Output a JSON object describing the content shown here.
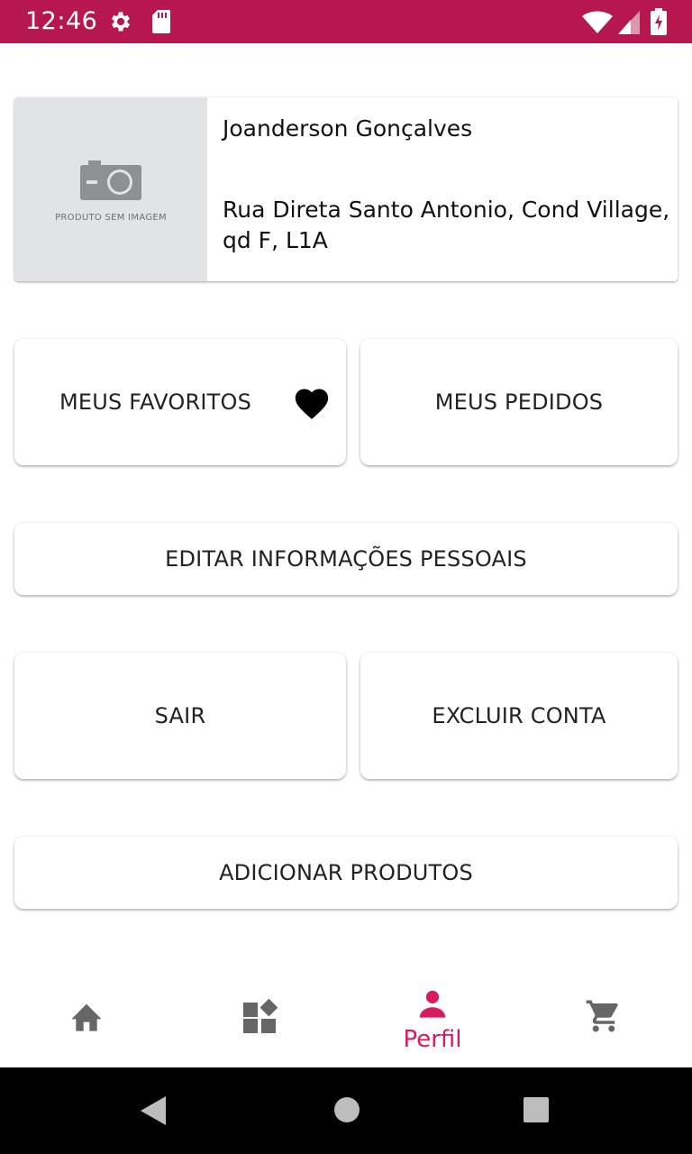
{
  "status_bar": {
    "time": "12:46",
    "icons": [
      "settings-icon",
      "sd-card-icon",
      "wifi-icon",
      "signal-icon",
      "battery-charging-icon"
    ],
    "background_color": "#b5174e"
  },
  "profile": {
    "name": "Joanderson Gonçalves",
    "address": "Rua Direta Santo Antonio, Cond Village, qd F, L1A",
    "no_image_text": "PRODUTO SEM IMAGEM",
    "placeholder_icon": "camera-icon"
  },
  "actions": {
    "favorites": {
      "label": "MEUS FAVORITOS",
      "icon": "heart-icon"
    },
    "orders": {
      "label": "MEUS PEDIDOS"
    },
    "edit_info": {
      "label": "EDITAR INFORMAÇÕES PESSOAIS"
    },
    "logout": {
      "label": "SAIR"
    },
    "delete_account": {
      "label": "EXCLUIR CONTA"
    },
    "add_products": {
      "label": "ADICIONAR PRODUTOS"
    }
  },
  "bottom_nav": {
    "items": [
      {
        "icon": "home-icon",
        "label": "",
        "active": false
      },
      {
        "icon": "categories-icon",
        "label": "",
        "active": false
      },
      {
        "icon": "person-icon",
        "label": "Perfil",
        "active": true
      },
      {
        "icon": "cart-icon",
        "label": "",
        "active": false
      }
    ],
    "active_color": "#d81b60",
    "inactive_color": "#666666"
  },
  "system_nav": {
    "buttons": [
      "back-icon",
      "home-circle-icon",
      "recents-icon"
    ]
  }
}
